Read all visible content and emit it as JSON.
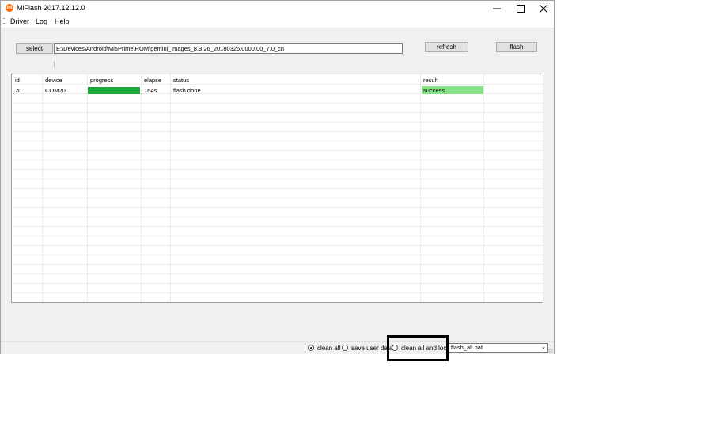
{
  "window": {
    "title": "MiFlash 2017.12.12.0",
    "icon_text": "mi"
  },
  "menu": {
    "items": [
      "Driver",
      "Log",
      "Help"
    ]
  },
  "toolbar": {
    "select_label": "select",
    "path_value": "E:\\Devices\\Android\\Mi5Prime\\ROM\\gemini_images_8.3.26_20180326.0000.00_7.0_cn",
    "refresh_label": "refresh",
    "flash_label": "flash"
  },
  "table": {
    "headers": [
      "id",
      "device",
      "progress",
      "elapse",
      "status",
      "result"
    ],
    "rows": [
      {
        "id": "20",
        "device": "COM20",
        "progress": 1.0,
        "elapse": "164s",
        "status": "flash done",
        "result": "success"
      }
    ]
  },
  "footer": {
    "options": [
      "clean all",
      "save user data",
      "clean all and lock"
    ],
    "selected_option": "clean all",
    "script_select": "flash_all.bat"
  },
  "colors": {
    "progress": "#1fa637",
    "success": "#86e386",
    "app_icon": "#ff6700"
  }
}
